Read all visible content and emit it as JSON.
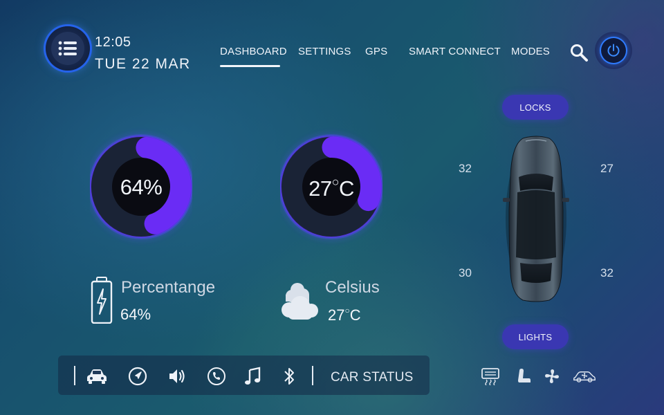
{
  "header": {
    "time": "12:05",
    "date": "TUE 22 MAR",
    "menu_icon": "list-menu-icon",
    "search_icon": "search-icon",
    "power_icon": "power-icon"
  },
  "nav": {
    "items": [
      {
        "label": "DASHBOARD",
        "active": true
      },
      {
        "label": "SETTINGS",
        "active": false
      },
      {
        "label": "GPS",
        "active": false
      },
      {
        "label": "SMART CONNECT",
        "active": false
      },
      {
        "label": "MODES",
        "active": false
      }
    ]
  },
  "battery": {
    "percent": 64,
    "gauge_text": "64%",
    "title": "Percentange",
    "value_text": "64%",
    "icon": "battery-charging-icon"
  },
  "temperature": {
    "value": 27,
    "gauge_number": "27",
    "gauge_unit": "C",
    "title": "Celsius",
    "value_number": "27",
    "value_unit": "C",
    "icon": "cloud-icon",
    "arc_fraction": 0.3
  },
  "car_panel": {
    "locks_label": "LOCKS",
    "lights_label": "LIGHTS",
    "tire_front_left": "32",
    "tire_front_right": "27",
    "tire_rear_left": "30",
    "tire_rear_right": "32"
  },
  "dock": {
    "icons": [
      "car-icon",
      "navigation-icon",
      "volume-icon",
      "phone-icon",
      "music-icon",
      "bluetooth-icon"
    ],
    "status_label": "CAR STATUS"
  },
  "climate": {
    "icons": [
      "rear-defrost-icon",
      "seat-heat-icon",
      "fan-icon",
      "car-ac-icon"
    ]
  },
  "colors": {
    "accent_purple": "#6a2cf5",
    "pill_bg": "#3a37b2",
    "power_ring": "#2f7bff",
    "gauge_dark": "#151a2b"
  }
}
